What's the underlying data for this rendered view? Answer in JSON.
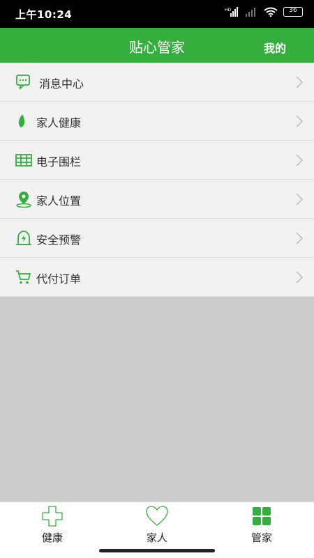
{
  "status_bar": {
    "time": "上午10:24",
    "battery": "36"
  },
  "header": {
    "title": "贴心管家",
    "mine": "我的"
  },
  "menu": [
    {
      "label": "消息中心",
      "icon": "message-icon"
    },
    {
      "label": "家人健康",
      "icon": "leaf-icon"
    },
    {
      "label": "电子围栏",
      "icon": "fence-icon"
    },
    {
      "label": "家人位置",
      "icon": "location-pin-icon"
    },
    {
      "label": "安全预警",
      "icon": "alarm-icon"
    },
    {
      "label": "代付订单",
      "icon": "cart-icon"
    }
  ],
  "bottom_nav": [
    {
      "label": "健康",
      "icon": "plus-outline-icon"
    },
    {
      "label": "家人",
      "icon": "heart-outline-icon"
    },
    {
      "label": "管家",
      "icon": "grid-icon",
      "active": true
    }
  ],
  "colors": {
    "brand": "#36ad3f",
    "background": "#cccccc",
    "menu_bg": "#f2f2f2"
  }
}
